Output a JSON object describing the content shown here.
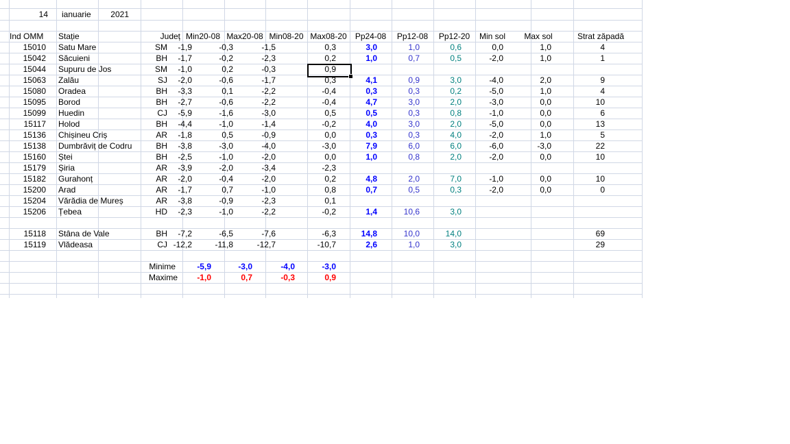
{
  "header": {
    "day": "14",
    "month": "ianuarie",
    "year": "2021"
  },
  "columns": [
    "Ind OMM",
    "Stație",
    "Județ",
    "Min20-08",
    "Max20-08",
    "Min08-20",
    "Max08-20",
    "Pp24-08",
    "Pp12-08",
    "Pp12-20",
    "Min sol",
    "Max sol",
    "Strat zăpadă"
  ],
  "rows": [
    [
      "15010",
      "Satu Mare",
      "SM",
      "-1,9",
      "-0,3",
      "-1,5",
      "0,3",
      "3,0",
      "1,0",
      "0,6",
      "0,0",
      "1,0",
      "4"
    ],
    [
      "15042",
      "Săcuieni",
      "BH",
      "-1,7",
      "-0,2",
      "-2,3",
      "0,2",
      "1,0",
      "0,7",
      "0,5",
      "-2,0",
      "1,0",
      "1"
    ],
    [
      "15044",
      "Supuru de Jos",
      "SM",
      "-1,0",
      "0,2",
      "-0,3",
      "0,9",
      "",
      "",
      "",
      "",
      "",
      ""
    ],
    [
      "15063",
      "Zalău",
      "SJ",
      "-2,0",
      "-0,6",
      "-1,7",
      "0,3",
      "4,1",
      "0,9",
      "3,0",
      "-4,0",
      "2,0",
      "9"
    ],
    [
      "15080",
      "Oradea",
      "BH",
      "-3,3",
      "0,1",
      "-2,2",
      "-0,4",
      "0,3",
      "0,3",
      "0,2",
      "-5,0",
      "1,0",
      "4"
    ],
    [
      "15095",
      "Borod",
      "BH",
      "-2,7",
      "-0,6",
      "-2,2",
      "-0,4",
      "4,7",
      "3,0",
      "2,0",
      "-3,0",
      "0,0",
      "10"
    ],
    [
      "15099",
      "Huedin",
      "CJ",
      "-5,9",
      "-1,6",
      "-3,0",
      "0,5",
      "0,5",
      "0,3",
      "0,8",
      "-1,0",
      "0,0",
      "6"
    ],
    [
      "15117",
      "Holod",
      "BH",
      "-4,4",
      "-1,0",
      "-1,4",
      "-0,2",
      "4,0",
      "3,0",
      "2,0",
      "-5,0",
      "0,0",
      "13"
    ],
    [
      "15136",
      "Chișineu   Criș",
      "AR",
      "-1,8",
      "0,5",
      "-0,9",
      "0,0",
      "0,3",
      "0,3",
      "4,0",
      "-2,0",
      "1,0",
      "5"
    ],
    [
      "15138",
      "Dumbrăviț  de Codru",
      "BH",
      "-3,8",
      "-3,0",
      "-4,0",
      "-3,0",
      "7,9",
      "6,0",
      "6,0",
      "-6,0",
      "-3,0",
      "22"
    ],
    [
      "15160",
      "Ștei",
      "BH",
      "-2,5",
      "-1,0",
      "-2,0",
      "0,0",
      "1,0",
      "0,8",
      "2,0",
      "-2,0",
      "0,0",
      "10"
    ],
    [
      "15179",
      "Șiria",
      "AR",
      "-3,9",
      "-2,0",
      "-3,4",
      "-2,3",
      "",
      "",
      "",
      "",
      "",
      ""
    ],
    [
      "15182",
      "Gurahonț",
      "AR",
      "-2,0",
      "-0,4",
      "-2,0",
      "0,2",
      "4,8",
      "2,0",
      "7,0",
      "-1,0",
      "0,0",
      "10"
    ],
    [
      "15200",
      "Arad",
      "AR",
      "-1,7",
      "0,7",
      "-1,0",
      "0,8",
      "0,7",
      "0,5",
      "0,3",
      "-2,0",
      "0,0",
      "0"
    ],
    [
      "15204",
      "Vărădia de Mureș",
      "AR",
      "-3,8",
      "-0,9",
      "-2,3",
      "0,1",
      "",
      "",
      "",
      "",
      "",
      ""
    ],
    [
      "15206",
      "Țebea",
      "HD",
      "-2,3",
      "-1,0",
      "-2,2",
      "-0,2",
      "1,4",
      "10,6",
      "3,0",
      "",
      "",
      ""
    ]
  ],
  "mountain_rows": [
    [
      "15118",
      "Stâna de Vale",
      "BH",
      "-7,2",
      "-6,5",
      "-7,6",
      "-6,3",
      "14,8",
      "10,0",
      "14,0",
      "",
      "",
      "69"
    ],
    [
      "15119",
      "Vlădeasa",
      "CJ",
      "-12,2",
      "-11,8",
      "-12,7",
      "-10,7",
      "2,6",
      "1,0",
      "3,0",
      "",
      "",
      "29"
    ]
  ],
  "summary": {
    "min_label": "Minime",
    "max_label": "Maxime",
    "min_values": [
      "-5,9",
      "-3,0",
      "-4,0",
      "-3,0"
    ],
    "max_values": [
      "-1,0",
      "0,7",
      "-0,3",
      "0,9"
    ]
  },
  "colors": {
    "gridline": "#d0d7e5",
    "pp24": "#0000ff",
    "pp12_08": "#3333cc",
    "pp12_20": "#007f7f",
    "minime": "#0000ff",
    "maxime": "#ff0000"
  }
}
